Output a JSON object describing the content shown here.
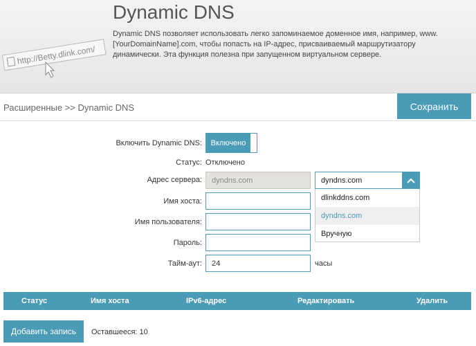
{
  "header": {
    "title": "Dynamic DNS",
    "description": "Dynamic DNS позволяет использовать легко запоминаемое доменное имя, например, www.[YourDomainName].com, чтобы попасть на IP-адрес, присваиваемый маршрутизатору динамически. Эта функция полезна при запущенном виртуальном сервере.",
    "illustration_text": "http://Betty.dlink.com/"
  },
  "breadcrumb": "Расширенные >> Dynamic DNS",
  "save_label": "Сохранить",
  "form": {
    "enable_label": "Включить Dynamic DNS:",
    "enable_value": "Включено",
    "status_label": "Статус:",
    "status_value": "Отключено",
    "server_label": "Адрес сервера:",
    "server_value": "dyndns.com",
    "host_label": "Имя хоста:",
    "host_value": "",
    "user_label": "Имя пользователя:",
    "user_value": "",
    "password_label": "Пароль:",
    "password_value": "",
    "timeout_label": "Тайм-аут:",
    "timeout_value": "24",
    "timeout_unit": "часы"
  },
  "server_dropdown": {
    "selected": "dyndns.com",
    "options": [
      "dlinkddns.com",
      "dyndns.com",
      "Вручную"
    ]
  },
  "table": {
    "columns": [
      "Статус",
      "Имя хоста",
      "IPv6-адрес",
      "Редактировать",
      "Удалить"
    ]
  },
  "add_record_label": "Добавить запись",
  "remaining_text": "Оставшееся: 10",
  "colors": {
    "accent": "#4a9bb6",
    "disabled_field": "#e4e2de"
  }
}
